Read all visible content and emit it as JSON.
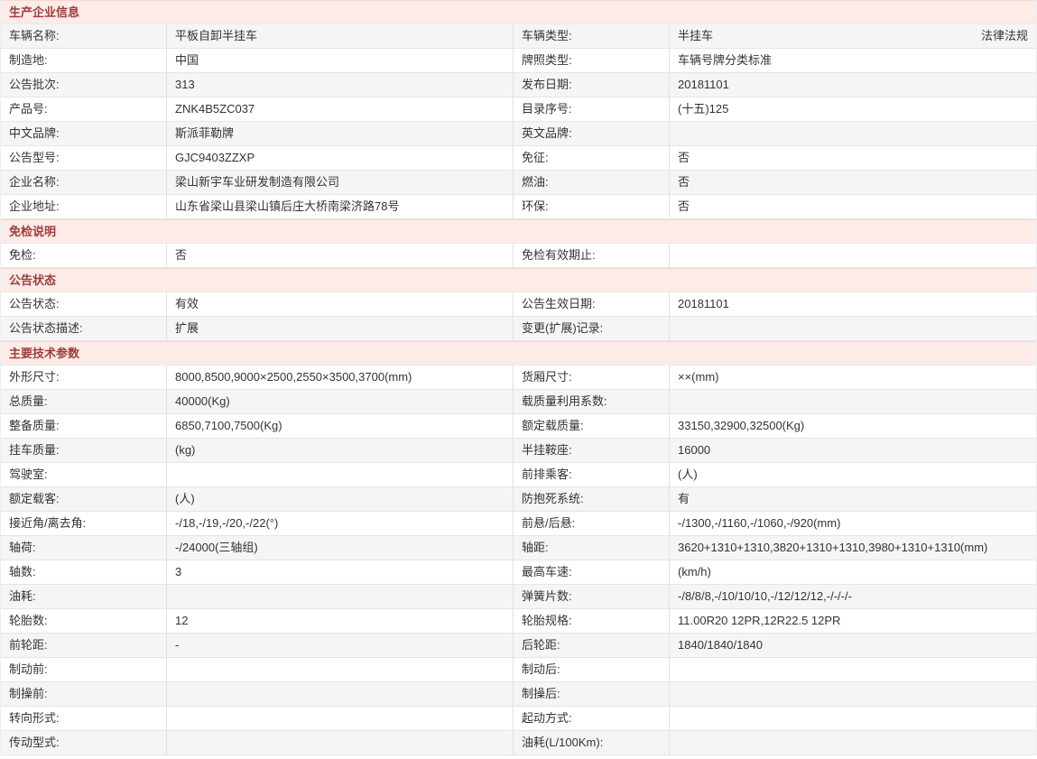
{
  "colors": {
    "section_header_bg": "#fcebe7",
    "section_header_text": "#9e3c3c",
    "shaded_row_bg": "#f5f5f6",
    "row_border": "#e5e5e5",
    "body_text": "#333333"
  },
  "sections": [
    {
      "title": "生产企业信息",
      "first_row_shaded": true,
      "rows": [
        {
          "l1": "车辆名称:",
          "v1": "平板自卸半挂车",
          "l2": "车辆类型:",
          "v2": "半挂车",
          "link": "法律法规"
        },
        {
          "l1": "制造地:",
          "v1": "中国",
          "l2": "牌照类型:",
          "v2": "车辆号牌分类标准"
        },
        {
          "l1": "公告批次:",
          "v1": "313",
          "l2": "发布日期:",
          "v2": "20181101"
        },
        {
          "l1": "产品号:",
          "v1": "ZNK4B5ZC037",
          "l2": "目录序号:",
          "v2": "(十五)125"
        },
        {
          "l1": "中文品牌:",
          "v1": "斯派菲勒牌",
          "l2": "英文品牌:",
          "v2": ""
        },
        {
          "l1": "公告型号:",
          "v1": "GJC9403ZZXP",
          "l2": "免征:",
          "v2": "否"
        },
        {
          "l1": "企业名称:",
          "v1": "梁山新宇车业研发制造有限公司",
          "l2": "燃油:",
          "v2": "否"
        },
        {
          "l1": "企业地址:",
          "v1": "山东省梁山县梁山镇后庄大桥南梁济路78号",
          "l2": "环保:",
          "v2": "否"
        }
      ]
    },
    {
      "title": "免检说明",
      "first_row_shaded": false,
      "rows": [
        {
          "l1": "免检:",
          "v1": "否",
          "l2": "免检有效期止:",
          "v2": ""
        }
      ]
    },
    {
      "title": "公告状态",
      "first_row_shaded": false,
      "rows": [
        {
          "l1": "公告状态:",
          "v1": "有效",
          "l2": "公告生效日期:",
          "v2": "20181101"
        },
        {
          "l1": "公告状态描述:",
          "v1": "扩展",
          "l2": "变更(扩展)记录:",
          "v2": ""
        }
      ]
    },
    {
      "title": "主要技术参数",
      "first_row_shaded": false,
      "rows": [
        {
          "l1": "外形尺寸:",
          "v1": "8000,8500,9000×2500,2550×3500,3700(mm)",
          "l2": "货厢尺寸:",
          "v2": "××(mm)"
        },
        {
          "l1": "总质量:",
          "v1": "40000(Kg)",
          "l2": "载质量利用系数:",
          "v2": ""
        },
        {
          "l1": "整备质量:",
          "v1": "6850,7100,7500(Kg)",
          "l2": "额定载质量:",
          "v2": "33150,32900,32500(Kg)"
        },
        {
          "l1": "挂车质量:",
          "v1": "(kg)",
          "l2": "半挂鞍座:",
          "v2": "16000"
        },
        {
          "l1": "驾驶室:",
          "v1": "",
          "l2": "前排乘客:",
          "v2": "(人)"
        },
        {
          "l1": "额定载客:",
          "v1": "(人)",
          "l2": "防抱死系统:",
          "v2": "有"
        },
        {
          "l1": "接近角/离去角:",
          "v1": "-/18,-/19,-/20,-/22(°)",
          "l2": "前悬/后悬:",
          "v2": "-/1300,-/1160,-/1060,-/920(mm)"
        },
        {
          "l1": "轴荷:",
          "v1": "-/24000(三轴组)",
          "l2": "轴距:",
          "v2": "3620+1310+1310,3820+1310+1310,3980+1310+1310(mm)"
        },
        {
          "l1": "轴数:",
          "v1": "3",
          "l2": "最高车速:",
          "v2": "(km/h)"
        },
        {
          "l1": "油耗:",
          "v1": "",
          "l2": "弹簧片数:",
          "v2": "-/8/8/8,-/10/10/10,-/12/12/12,-/-/-/-"
        },
        {
          "l1": "轮胎数:",
          "v1": "12",
          "l2": "轮胎规格:",
          "v2": "11.00R20 12PR,12R22.5 12PR"
        },
        {
          "l1": "前轮距:",
          "v1": "-",
          "l2": "后轮距:",
          "v2": "1840/1840/1840"
        },
        {
          "l1": "制动前:",
          "v1": "",
          "l2": "制动后:",
          "v2": ""
        },
        {
          "l1": "制操前:",
          "v1": "",
          "l2": "制操后:",
          "v2": ""
        },
        {
          "l1": "转向形式:",
          "v1": "",
          "l2": "起动方式:",
          "v2": ""
        },
        {
          "l1": "传动型式:",
          "v1": "",
          "l2": "油耗(L/100Km):",
          "v2": ""
        }
      ]
    }
  ]
}
